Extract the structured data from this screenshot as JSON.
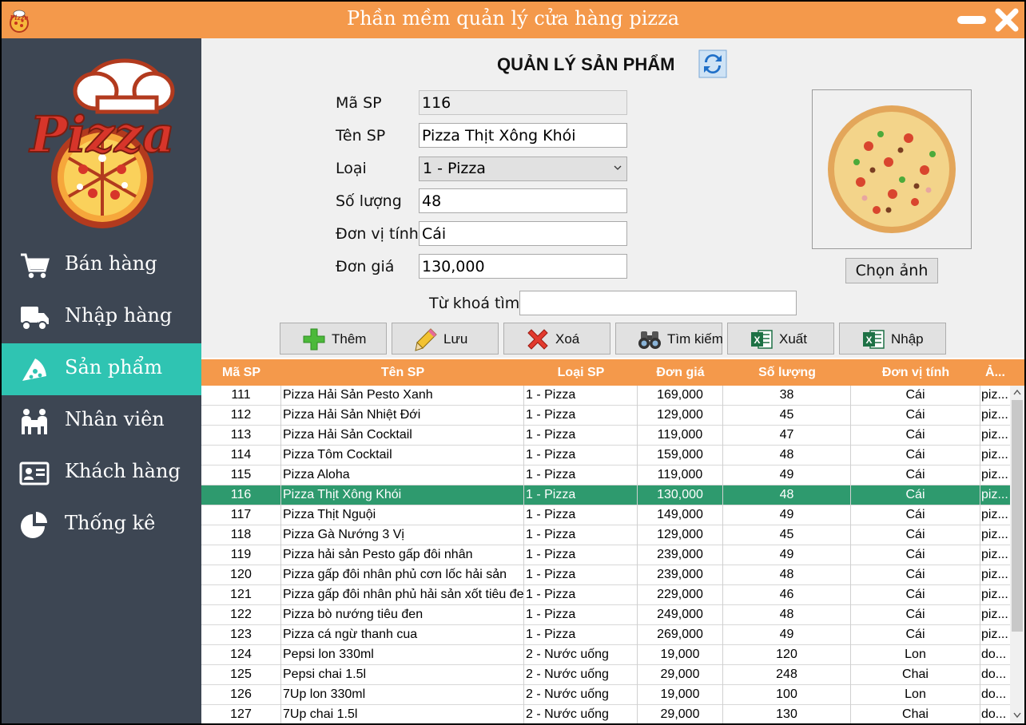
{
  "window": {
    "title": "Phần mềm quản lý cửa hàng pizza"
  },
  "sidebar": {
    "logo_text": "Pizza",
    "items": [
      {
        "label": "Bán hàng",
        "icon": "cart-icon",
        "active": false
      },
      {
        "label": "Nhập hàng",
        "icon": "truck-icon",
        "active": false
      },
      {
        "label": "Sản phẩm",
        "icon": "pizza-slice-icon",
        "active": true
      },
      {
        "label": "Nhân viên",
        "icon": "staff-icon",
        "active": false
      },
      {
        "label": "Khách hàng",
        "icon": "id-card-icon",
        "active": false
      },
      {
        "label": "Thống kê",
        "icon": "pie-chart-icon",
        "active": false
      }
    ]
  },
  "page": {
    "title": "QUẢN LÝ SẢN PHẨM"
  },
  "form": {
    "ma_sp": {
      "label": "Mã SP",
      "value": "116"
    },
    "ten_sp": {
      "label": "Tên SP",
      "value": "Pizza Thịt Xông Khói"
    },
    "loai": {
      "label": "Loại",
      "value": "1 - Pizza"
    },
    "so_luong": {
      "label": "Số lượng",
      "value": "48"
    },
    "don_vi": {
      "label": "Đơn vị tính",
      "value": "Cái"
    },
    "don_gia": {
      "label": "Đơn giá",
      "value": "130,000"
    },
    "choose_image": "Chọn ảnh",
    "search": {
      "label": "Từ khoá tìm",
      "value": ""
    }
  },
  "toolbar": {
    "add": "Thêm",
    "save": "Lưu",
    "delete": "Xoá",
    "search": "Tìm kiếm",
    "export": "Xuất",
    "import": "Nhập"
  },
  "table": {
    "headers": [
      "Mã SP",
      "Tên SP",
      "Loại SP",
      "Đơn giá",
      "Số lượng",
      "Đơn vị tính",
      "Ả..."
    ],
    "rows": [
      [
        "111",
        "Pizza Hải Sản Pesto Xanh",
        "1 - Pizza",
        "169,000",
        "38",
        "Cái",
        "piz..."
      ],
      [
        "112",
        "Pizza Hải Sản Nhiệt Đới",
        "1 - Pizza",
        "129,000",
        "45",
        "Cái",
        "piz..."
      ],
      [
        "113",
        "Pizza Hải Sản Cocktail",
        "1 - Pizza",
        "119,000",
        "47",
        "Cái",
        "piz..."
      ],
      [
        "114",
        "Pizza Tôm Cocktail",
        "1 - Pizza",
        "159,000",
        "48",
        "Cái",
        "piz..."
      ],
      [
        "115",
        "Pizza Aloha",
        "1 - Pizza",
        "119,000",
        "49",
        "Cái",
        "piz..."
      ],
      [
        "116",
        "Pizza Thịt Xông Khói",
        "1 - Pizza",
        "130,000",
        "48",
        "Cái",
        "piz..."
      ],
      [
        "117",
        "Pizza Thịt Nguội",
        "1 - Pizza",
        "149,000",
        "49",
        "Cái",
        "piz..."
      ],
      [
        "118",
        "Pizza Gà Nướng 3 Vị",
        "1 - Pizza",
        "129,000",
        "45",
        "Cái",
        "piz..."
      ],
      [
        "119",
        "Pizza hải sản Pesto gấp đôi nhân",
        "1 - Pizza",
        "239,000",
        "49",
        "Cái",
        "piz..."
      ],
      [
        "120",
        "Pizza gấp đôi nhân phủ cơn lốc hải sản",
        "1 - Pizza",
        "239,000",
        "48",
        "Cái",
        "piz..."
      ],
      [
        "121",
        "Pizza gấp đôi nhân phủ hải sản xốt tiêu đen",
        "1 - Pizza",
        "229,000",
        "46",
        "Cái",
        "piz..."
      ],
      [
        "122",
        "Pizza bò nướng tiêu đen",
        "1 - Pizza",
        "249,000",
        "48",
        "Cái",
        "piz..."
      ],
      [
        "123",
        "Pizza cá ngừ thanh cua",
        "1 - Pizza",
        "269,000",
        "49",
        "Cái",
        "piz..."
      ],
      [
        "124",
        "Pepsi lon 330ml",
        "2 - Nước uống",
        "19,000",
        "120",
        "Lon",
        "do..."
      ],
      [
        "125",
        "Pepsi chai 1.5l",
        "2 - Nước uống",
        "29,000",
        "248",
        "Chai",
        "do..."
      ],
      [
        "126",
        "7Up lon 330ml",
        "2 - Nước uống",
        "19,000",
        "100",
        "Lon",
        "do..."
      ],
      [
        "127",
        "7Up chai 1.5l",
        "2 - Nước uống",
        "29,000",
        "130",
        "Chai",
        "do..."
      ]
    ],
    "selected_index": 5
  },
  "colors": {
    "accent": "#f4994b",
    "sidebar": "#3d4653",
    "active_nav": "#2fc4b2",
    "selected_row": "#2e9a6e"
  }
}
